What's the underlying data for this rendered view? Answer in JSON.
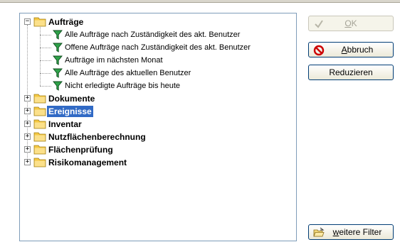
{
  "tree": {
    "root_folders": [
      {
        "label": "Aufträge",
        "expanded": true
      },
      {
        "label": "Dokumente",
        "expanded": false
      },
      {
        "label": "Ereignisse",
        "expanded": false,
        "selected": true
      },
      {
        "label": "Inventar",
        "expanded": false
      },
      {
        "label": "Nutzflächenberechnung",
        "expanded": false
      },
      {
        "label": "Flächenprüfung",
        "expanded": false
      },
      {
        "label": "Risikomanagement",
        "expanded": false
      }
    ],
    "auftraege_filters": [
      "Alle Aufträge nach Zuständigkeit des akt. Benutzer",
      "Offene Aufträge nach Zuständigkeit des akt. Benutzer",
      "Aufträge im nächsten Monat",
      "Alle Aufträge des aktuellen Benutzer",
      "Nicht erledigte Aufträge bis heute"
    ]
  },
  "buttons": {
    "ok": {
      "label": "OK",
      "accel": "O",
      "enabled": false
    },
    "cancel": {
      "label": "Abbruch",
      "accel": "A"
    },
    "reduce": {
      "label": "Reduzieren"
    },
    "more_filters": {
      "label": "weitere Filter",
      "accel": "w"
    }
  },
  "colors": {
    "selection": "#316ac5",
    "folder": "#f5c842",
    "funnel": "#1f8f3a",
    "cancel_icon": "#cc0000"
  }
}
